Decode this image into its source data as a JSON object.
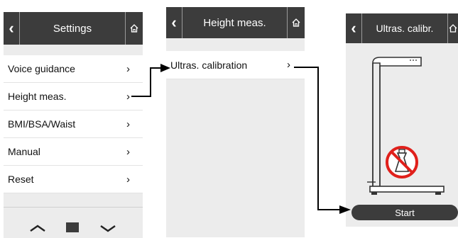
{
  "screens": {
    "settings": {
      "title": "Settings",
      "back_icon": "chevron-left-icon",
      "home_icon": "home-icon",
      "items": [
        {
          "label": "Voice guidance",
          "chevron": "›"
        },
        {
          "label": "Height meas.",
          "chevron": "›"
        },
        {
          "label": "BMI/BSA/Waist",
          "chevron": "›"
        },
        {
          "label": "Manual",
          "chevron": "›"
        },
        {
          "label": "Reset",
          "chevron": "›"
        }
      ],
      "nav": {
        "up_icon": "chevron-up-icon",
        "down_icon": "chevron-down-icon",
        "page_indicator": "page-indicator-icon"
      }
    },
    "height_meas": {
      "title": "Height meas.",
      "back_icon": "chevron-left-icon",
      "home_icon": "home-icon",
      "items": [
        {
          "label": "Ultras. calibration",
          "chevron": "›"
        }
      ]
    },
    "ultras_calibr": {
      "title": "Ultras. calibr.",
      "back_icon": "chevron-left-icon",
      "home_icon": "home-icon",
      "illustration": "height-measuring-station-no-weight-icon",
      "start_label": "Start"
    }
  },
  "flow_arrows": [
    "settings-to-height-meas-arrow",
    "height-meas-to-ultras-calibr-arrow"
  ],
  "colors": {
    "topbar": "#3c3c3c",
    "screen_bg": "#ececec",
    "item_bg": "#ffffff",
    "prohibit_red": "#e0201b"
  }
}
